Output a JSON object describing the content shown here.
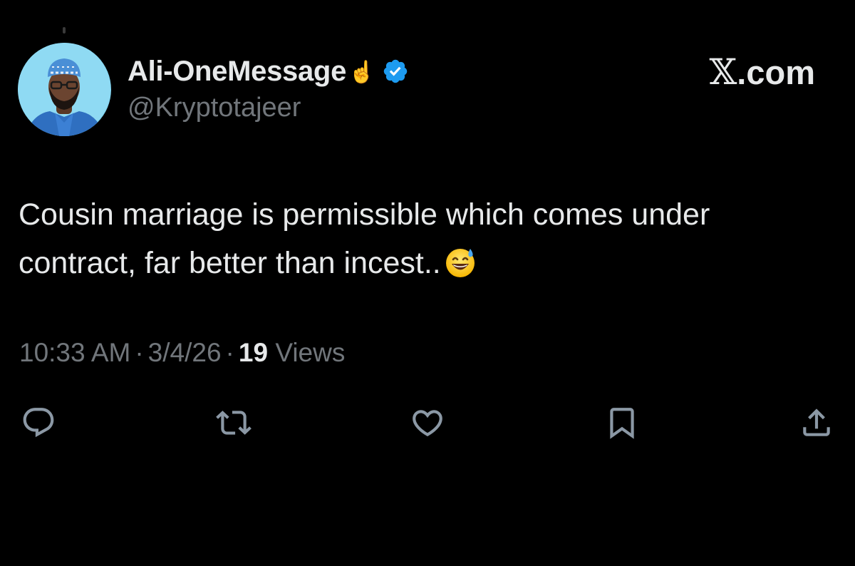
{
  "author": {
    "display_name": "Ali-OneMessage",
    "name_emoji": "☝️",
    "handle": "@Kryptotajeer",
    "verified": true
  },
  "brand": {
    "x_glyph": "𝕏",
    "suffix": ".com"
  },
  "tweet": {
    "line1": "Cousin marriage is permissible which comes under",
    "line2": "contract, far better than incest..",
    "emoji": "grinning-face-with-sweat"
  },
  "meta": {
    "time": "10:33 AM",
    "separator": "·",
    "date": "3/4/26",
    "views_count": "19",
    "views_label": "Views"
  },
  "actions": [
    "reply",
    "repost",
    "like",
    "bookmark",
    "share"
  ],
  "colors": {
    "background": "#000000",
    "text": "#e7e9ea",
    "secondary": "#71767b",
    "verified_blue": "#1d9bf0",
    "action_icon": "#8b98a5"
  }
}
